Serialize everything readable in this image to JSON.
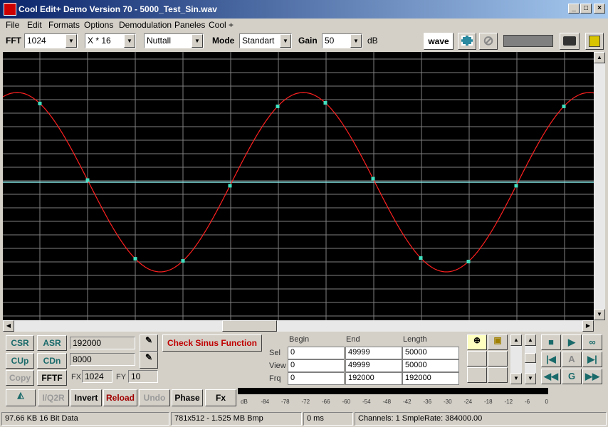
{
  "window": {
    "title": "Cool Edit+ Demo Version 70 - 5000_Test_Sin.wav",
    "controls": [
      "_",
      "□",
      "×"
    ]
  },
  "menu": [
    "File",
    "Edit",
    "Formats",
    "Options",
    "Demodulation",
    "Paneles",
    "Cool +"
  ],
  "toolbar": {
    "fft_label": "FFT",
    "fft_value": "1024",
    "zoom_value": "X * 16",
    "window_value": "Nuttall",
    "mode_label": "Mode",
    "mode_value": "Standart",
    "gain_label": "Gain",
    "gain_value": "50",
    "gain_unit": "dB",
    "wave_button": "wave"
  },
  "display": {
    "background": "#000000",
    "grid_color": "#808080",
    "wave_color": "#ff2020",
    "marker_color": "#40e0c0",
    "center_line_color": "#80e0e0"
  },
  "panel": {
    "csr": "CSR",
    "asr": "ASR",
    "asr_value": "192000",
    "cup": "CUp",
    "cdn": "CDn",
    "cdn_value": "8000",
    "copy": "Copy",
    "fftf": "FFTF",
    "fx_label": "FX",
    "fx_value": "1024",
    "fy_label": "FY",
    "fy_value": "10",
    "check_button": "Check Sinus Function",
    "table": {
      "headers": [
        "Begin",
        "End",
        "Length"
      ],
      "rows": [
        {
          "label": "Sel",
          "begin": "0",
          "end": "49999",
          "length": "50000"
        },
        {
          "label": "View",
          "begin": "0",
          "end": "49999",
          "length": "50000"
        },
        {
          "label": "Frq",
          "begin": "0",
          "end": "192000",
          "length": "192000"
        }
      ]
    },
    "transport": [
      "■",
      "▶",
      "∞",
      "|◀",
      "A",
      "▶|",
      "◀◀",
      "G",
      "▶▶"
    ]
  },
  "bottom_buttons": [
    "I/Q2R",
    "Invert",
    "Reload",
    "Undo",
    "Phase",
    "Fx"
  ],
  "meter": {
    "labels": [
      "dB",
      "-84",
      "-78",
      "-72",
      "-66",
      "-60",
      "-54",
      "-48",
      "-42",
      "-36",
      "-30",
      "-24",
      "-18",
      "-12",
      "-6",
      "0"
    ]
  },
  "status": {
    "info": "97.66 KB 16 Bit Data",
    "bmp": "781x512 - 1.525 MB Bmp",
    "time": "0 ms",
    "channels": "Channels: 1  SmpleRate: 384000.00"
  }
}
